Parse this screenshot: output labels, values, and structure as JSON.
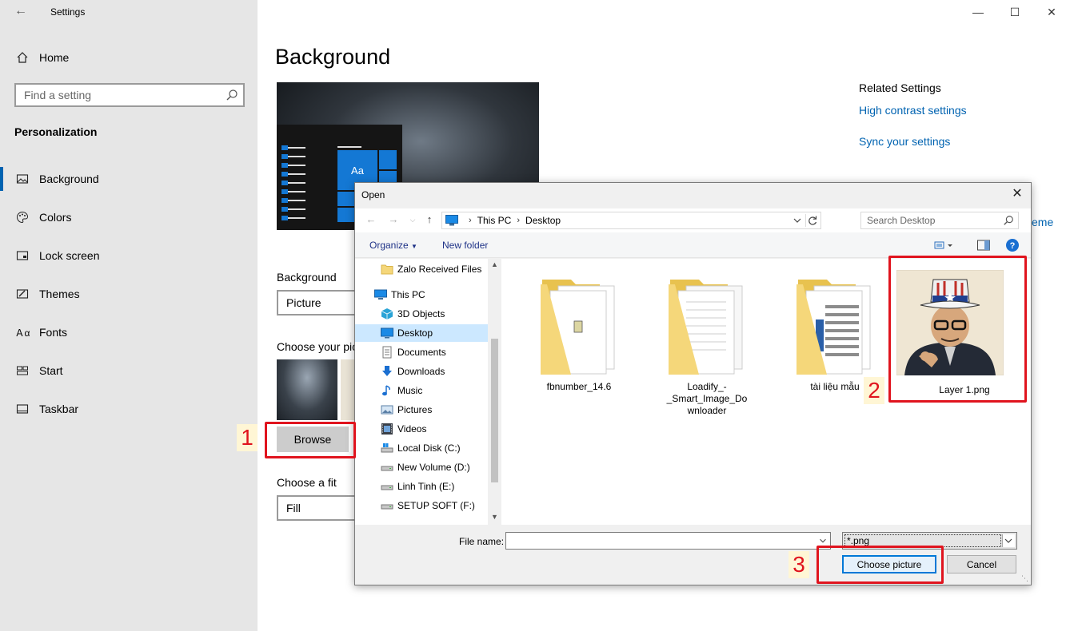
{
  "settings": {
    "title": "Settings",
    "home": "Home",
    "search_placeholder": "Find a setting",
    "section": "Personalization",
    "nav": [
      {
        "label": "Background",
        "icon": "image-icon"
      },
      {
        "label": "Colors",
        "icon": "palette-icon"
      },
      {
        "label": "Lock screen",
        "icon": "lock-screen-icon"
      },
      {
        "label": "Themes",
        "icon": "themes-icon"
      },
      {
        "label": "Fonts",
        "icon": "fonts-icon"
      },
      {
        "label": "Start",
        "icon": "start-icon"
      },
      {
        "label": "Taskbar",
        "icon": "taskbar-icon"
      }
    ]
  },
  "main": {
    "title": "Background",
    "preview_tile": "Aa",
    "background_label": "Background",
    "background_value": "Picture",
    "choose_picture_label": "Choose your pic",
    "browse": "Browse",
    "fit_label": "Choose a fit",
    "fit_value": "Fill",
    "related_title": "Related Settings",
    "related_links": [
      "High contrast settings",
      "Sync your settings"
    ],
    "cut_link": "eme"
  },
  "dialog": {
    "title": "Open",
    "breadcrumb": [
      "This PC",
      "Desktop"
    ],
    "search_placeholder": "Search Desktop",
    "organize": "Organize",
    "new_folder": "New folder",
    "tree": [
      {
        "label": "Zalo Received Files",
        "icon": "folder-icon"
      },
      {
        "label": "This PC",
        "icon": "pc-icon"
      },
      {
        "label": "3D Objects",
        "icon": "3d-objects-icon"
      },
      {
        "label": "Desktop",
        "icon": "desktop-icon"
      },
      {
        "label": "Documents",
        "icon": "documents-icon"
      },
      {
        "label": "Downloads",
        "icon": "downloads-icon"
      },
      {
        "label": "Music",
        "icon": "music-icon"
      },
      {
        "label": "Pictures",
        "icon": "pictures-icon"
      },
      {
        "label": "Videos",
        "icon": "videos-icon"
      },
      {
        "label": "Local Disk (C:)",
        "icon": "disk-icon"
      },
      {
        "label": "New Volume (D:)",
        "icon": "drive-icon"
      },
      {
        "label": "Linh Tinh (E:)",
        "icon": "drive-icon"
      },
      {
        "label": "SETUP SOFT (F:)",
        "icon": "drive-icon"
      }
    ],
    "files": [
      {
        "name": "fbnumber_14.6"
      },
      {
        "name": "Loadify_-_Smart_Image_Do",
        "name2": "wnloader"
      },
      {
        "name": "tài liệu mẫu"
      },
      {
        "name": "Layer 1.png"
      }
    ],
    "file_name_label": "File name:",
    "file_name_value": "",
    "filter": "*.png",
    "choose_button": "Choose picture",
    "cancel_button": "Cancel"
  },
  "annotations": [
    "1",
    "2",
    "3"
  ],
  "colors": {
    "accent": "#0063b1",
    "annotation": "#e0141e",
    "folder": "#f5d77a"
  }
}
